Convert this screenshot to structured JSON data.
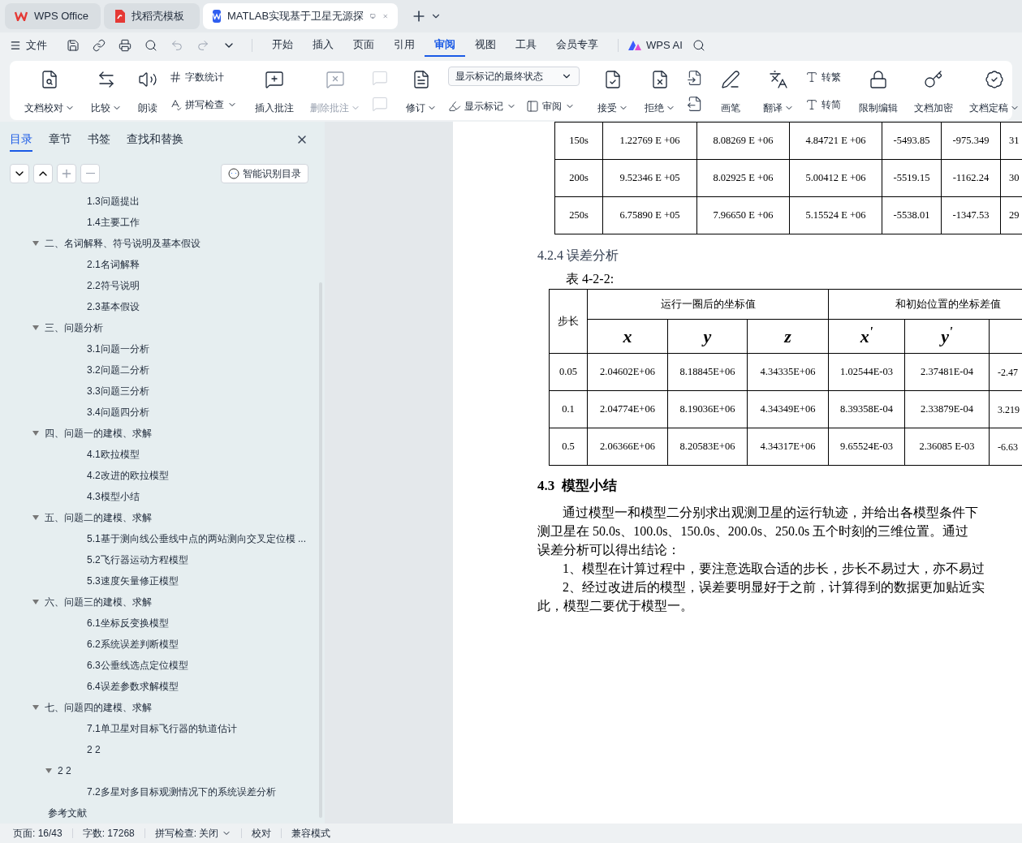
{
  "browser_tabs": [
    {
      "label": "WPS Office",
      "kind": "wps",
      "selected": false
    },
    {
      "label": "找稻壳模板",
      "kind": "template",
      "selected": false
    },
    {
      "label": "MATLAB实现基于卫星无源探",
      "kind": "doc",
      "selected": true
    }
  ],
  "menu": {
    "file": "文件",
    "tabs": [
      {
        "label": "开始",
        "selected": false
      },
      {
        "label": "插入",
        "selected": false
      },
      {
        "label": "页面",
        "selected": false
      },
      {
        "label": "引用",
        "selected": false
      },
      {
        "label": "审阅",
        "selected": true
      },
      {
        "label": "视图",
        "selected": false
      },
      {
        "label": "工具",
        "selected": false
      },
      {
        "label": "会员专享",
        "selected": false
      }
    ],
    "ai": "WPS AI"
  },
  "ribbon": [
    {
      "items": [
        {
          "kind": "large",
          "label": "文档校对",
          "menu": true,
          "disabled": false
        },
        {
          "kind": "large",
          "label": "比较",
          "menu": true,
          "disabled": false
        },
        {
          "kind": "large",
          "label": "朗读",
          "menu": false,
          "disabled": false
        },
        {
          "kind": "pair",
          "items": [
            {
              "label": "字数统计",
              "menu": false
            },
            {
              "label": "拼写检查",
              "menu": true
            }
          ]
        }
      ]
    },
    {
      "items": [
        {
          "kind": "large",
          "label": "插入批注",
          "menu": false,
          "disabled": false
        },
        {
          "kind": "large",
          "label": "删除批注",
          "menu": true,
          "disabled": true
        },
        {
          "kind": "icons",
          "disabled": true
        }
      ]
    },
    {
      "items": [
        {
          "kind": "large",
          "label": "修订",
          "menu": true,
          "disabled": false
        },
        {
          "kind": "select",
          "value": "显示标记的最终状态",
          "items": [
            {
              "label": "显示标记",
              "menu": true
            },
            {
              "label": "审阅",
              "menu": true
            }
          ]
        }
      ]
    },
    {
      "items": [
        {
          "kind": "large",
          "label": "接受",
          "menu": true,
          "disabled": false
        },
        {
          "kind": "large",
          "label": "拒绝",
          "menu": true,
          "disabled": false
        },
        {
          "kind": "icons",
          "disabled": false
        }
      ]
    },
    {
      "items": [
        {
          "kind": "large",
          "label": "画笔",
          "menu": false,
          "disabled": false
        }
      ]
    },
    {
      "items": [
        {
          "kind": "large",
          "label": "翻译",
          "menu": true,
          "disabled": false
        },
        {
          "kind": "pair",
          "items": [
            {
              "label": "转繁",
              "menu": false
            },
            {
              "label": "转简",
              "menu": false
            }
          ]
        }
      ]
    },
    {
      "items": [
        {
          "kind": "large",
          "label": "限制编辑",
          "menu": false,
          "disabled": false
        },
        {
          "kind": "large",
          "label": "文档加密",
          "menu": false,
          "disabled": false
        },
        {
          "kind": "large",
          "label": "文档定稿",
          "menu": true,
          "disabled": false
        }
      ]
    }
  ],
  "nav_pane": {
    "tabs": [
      {
        "label": "目录",
        "selected": true
      },
      {
        "label": "章节",
        "selected": false
      },
      {
        "label": "书签",
        "selected": false
      },
      {
        "label": "查找和替换",
        "selected": false
      }
    ],
    "smart_button": "智能识别目录",
    "leading_items": [
      "1.3问题提出",
      "1.4主要工作"
    ],
    "tree": [
      {
        "label": "二、名词解释、符号说明及基本假设",
        "expanded": true,
        "children": [
          {
            "label": "2.1名词解释"
          },
          {
            "label": "2.2符号说明"
          },
          {
            "label": "2.3基本假设"
          }
        ]
      },
      {
        "label": "三、问题分析",
        "expanded": true,
        "children": [
          {
            "label": "3.1问题一分析"
          },
          {
            "label": "3.2问题二分析"
          },
          {
            "label": "3.3问题三分析"
          },
          {
            "label": "3.4问题四分析"
          }
        ]
      },
      {
        "label": "四、问题一的建模、求解",
        "expanded": true,
        "children": [
          {
            "label": "4.1欧拉模型"
          },
          {
            "label": "4.2改进的欧拉模型"
          },
          {
            "label": "4.3模型小结"
          }
        ]
      },
      {
        "label": "五、问题二的建模、求解",
        "expanded": true,
        "children": [
          {
            "label": "5.1基于测向线公垂线中点的两站测向交叉定位模 ..."
          },
          {
            "label": "5.2飞行器运动方程模型"
          },
          {
            "label": "5.3速度矢量修正模型"
          }
        ]
      },
      {
        "label": "六、问题三的建模、求解",
        "expanded": true,
        "children": [
          {
            "label": "6.1坐标反变换模型"
          },
          {
            "label": "6.2系统误差判断模型"
          },
          {
            "label": "6.3公垂线选点定位模型"
          },
          {
            "label": "6.4误差参数求解模型"
          }
        ]
      },
      {
        "label": "七、问题四的建模、求解",
        "expanded": true,
        "children": [
          {
            "label": "7.1单卫星对目标飞行器的轨道估计"
          },
          {
            "label": "2 2"
          },
          {
            "label": "2 2",
            "expanded": true,
            "children": [
              {
                "label": "7.2多星对多目标观测情况下的系统误差分析"
              }
            ]
          }
        ]
      },
      {
        "label": "参考文献"
      }
    ]
  },
  "document": {
    "table_1": {
      "rows": [
        [
          "150s",
          "1.22769 E +06",
          "8.08269 E +06",
          "4.84721 E +06",
          "-5493.85",
          "-975.349",
          "31"
        ],
        [
          "200s",
          "9.52346 E +05",
          "8.02925 E +06",
          "5.00412 E +06",
          "-5519.15",
          "-1162.24",
          "30"
        ],
        [
          "250s",
          "6.75890 E +05",
          "7.96650 E +06",
          "5.15524 E +06",
          "-5538.01",
          "-1347.53",
          "29"
        ]
      ]
    },
    "heading_1": {
      "number": "4.2.4",
      "title": "误差分析"
    },
    "caption": "表 4-2-2:",
    "table_2": {
      "corner": "步长",
      "group_1": "运行一圈后的坐标值",
      "group_2": "和初始位置的坐标差值",
      "columns": [
        "",
        "x",
        "y",
        "z",
        "x$^{'}$",
        "y$^{'}$"
      ],
      "rows": [
        [
          "0.05",
          "2.04602E+06",
          "8.18845E+06",
          "4.34335E+06",
          "1.02544E-03",
          "2.37481E-04",
          "-2.47"
        ],
        [
          "0.1",
          "2.04774E+06",
          "8.19036E+06",
          "4.34349E+06",
          "8.39358E-04",
          "2.33879E-04",
          "3.219"
        ],
        [
          "0.5",
          "2.06366E+06",
          "8.20583E+06",
          "4.34317E+06",
          "9.65524E-03",
          "2.36085 E-03",
          "-6.63"
        ]
      ]
    },
    "heading_2": {
      "number": "4.3",
      "title": "模型小结"
    },
    "paragraphs": [
      [
        "通过模型一和模型二分别求出观测卫星的运行轨迹，并给出各模型条件下",
        "测卫星在 50.0s、100.0s、150.0s、200.0s、250.0s 五个时刻的三维位置。通过",
        "误差分析可以得出结论："
      ],
      [
        "1、模型在计算过程中，要注意选取合适的步长，步长不易过大，亦不易过"
      ],
      [
        "2、经过改进后的模型，误差要明显好于之前，计算得到的数据更加贴近实",
        "此，模型二要优于模型一。"
      ]
    ]
  },
  "status_bar": [
    {
      "label": "页面: 16/43",
      "menu": false
    },
    {
      "label": "字数: 17268",
      "menu": false
    },
    {
      "label": "拼写检查: 关闭",
      "menu": true
    },
    {
      "label": "校对",
      "menu": false
    },
    {
      "label": "兼容模式",
      "menu": false
    }
  ]
}
